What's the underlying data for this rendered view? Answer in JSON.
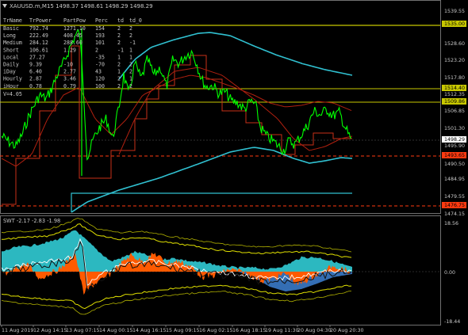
{
  "window": {
    "symbol_header": "XAUUSD.m,M15  1498.37  1498.61  1498.29  1498.29"
  },
  "main_panel": {
    "price_labels": [
      "1539.55",
      "1535.00",
      "1528.60",
      "1523.20",
      "1517.80",
      "1514.40",
      "1512.35",
      "1509.86",
      "1506.85",
      "1501.30",
      "1498.29",
      "1495.90",
      "1493.65",
      "1490.50",
      "1484.95",
      "1479.55",
      "1476.75",
      "1474.15"
    ],
    "trader_table": {
      "headers": [
        "TrName",
        "TrPower",
        "PartPow",
        "Perc",
        "td",
        "td_0"
      ],
      "rows": [
        [
          "Basic",
          "792.74",
          "1271.10",
          "154",
          "2",
          "2"
        ],
        [
          "Long",
          "222.49",
          "408.45",
          "193",
          "2",
          "2"
        ],
        [
          "Medium",
          "284.12",
          "288.60",
          "101",
          "2",
          "-1"
        ],
        [
          "Short",
          "106.61",
          "1.29",
          "2",
          "-1",
          "1"
        ],
        [
          "Local",
          "27.27",
          "",
          "-35",
          "1",
          "1"
        ],
        [
          "Daily",
          "9.39",
          "-10",
          "-70",
          "2",
          "2"
        ],
        [
          "iDay",
          "6.40",
          "2.77",
          "43",
          "1",
          "2"
        ],
        [
          "Hourly",
          "2.87",
          "3.46",
          "120",
          "2",
          "1"
        ],
        [
          "iHour",
          "0.78",
          "0.79",
          "100",
          "2",
          "2"
        ]
      ],
      "vline": "V=4.05"
    }
  },
  "sub_panel": {
    "header": "SWT -2.17 -2.83 -1.98",
    "scale_labels": [
      "18.56",
      "0.00",
      "-18.44"
    ]
  },
  "time_axis": [
    "11 Aug 2019",
    "12 Aug 14:15",
    "13 Aug 07:15",
    "14 Aug 00:15",
    "14 Aug 16:15",
    "15 Aug 09:15",
    "16 Aug 02:15",
    "16 Aug 18:15",
    "19 Aug 11:30",
    "20 Aug 04:30",
    "20 Aug 20:30"
  ],
  "colors": {
    "price": "#00ff00",
    "ma": "#30c0d0",
    "step": "#c83018",
    "yellow_line": "#c8c800",
    "dashed_red": "#ff3a10",
    "sub_fill_cyan": "#30c8d0",
    "sub_fill_orange": "#ff5a00",
    "sub_fill_blue": "#3a7ac8",
    "sub_band": "#e0e000"
  }
}
